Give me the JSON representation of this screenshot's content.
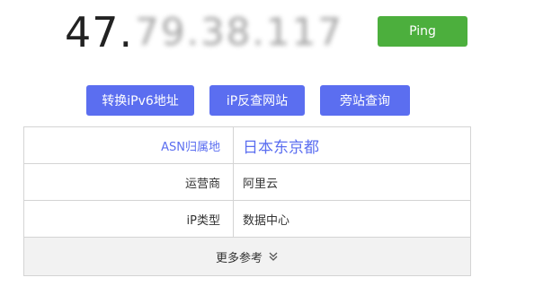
{
  "ip": {
    "visible_prefix": "47.",
    "masked_part": "79.38.117"
  },
  "ping_button": {
    "label": "Ping",
    "color": "#4caf3d"
  },
  "actions": {
    "ipv6_label": "转换iPv6地址",
    "reverse_label": "iP反查网站",
    "side_label": "旁站查询",
    "color": "#5b6ef0"
  },
  "table": {
    "rows": [
      {
        "label": "ASN归属地",
        "value": "日本东京都"
      },
      {
        "label": "运营商",
        "value": "阿里云"
      },
      {
        "label": "iP类型",
        "value": "数据中心"
      }
    ],
    "more_label": "更多参考",
    "more_icon": "double-chevron-down-icon"
  }
}
